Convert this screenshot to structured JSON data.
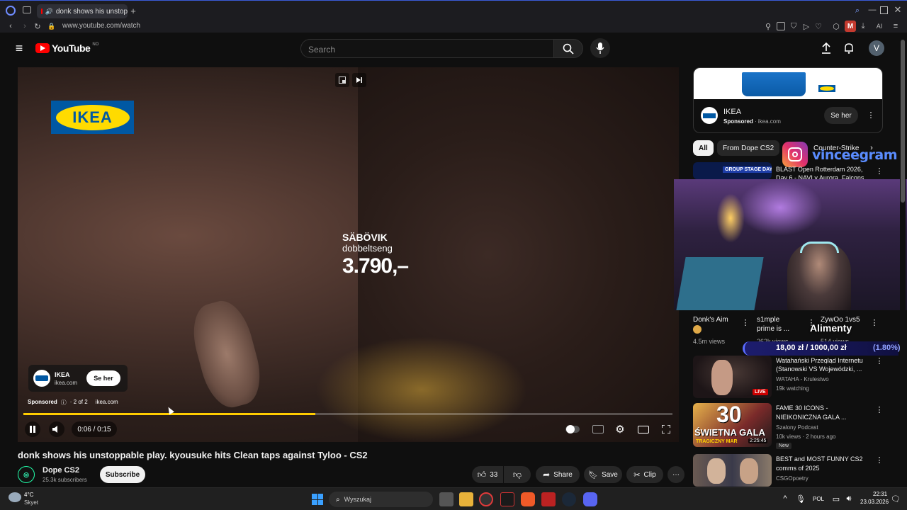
{
  "browser": {
    "tab_title": "donk shows his unstop",
    "url": "www.youtube.com/watch",
    "ai_label": "AI"
  },
  "header": {
    "logo_text": "YouTube",
    "region": "NO",
    "search_placeholder": "Search",
    "avatar_letter": "V"
  },
  "ad_video": {
    "product_name": "SÄBÖVIK",
    "product_desc": "dobbeltseng",
    "price": "3.790,–",
    "logo_text": "IKEA",
    "overlay_name": "IKEA",
    "overlay_domain": "ikea.com",
    "overlay_button": "Se her",
    "sponsored_label": "Sponsored",
    "ad_count": "· 2 of 2",
    "ad_domain": "ikea.com",
    "progress_fraction": 0.45,
    "time_display": "0:06 / 0:15"
  },
  "video": {
    "title": "donk shows his unstoppable play. kyousuke hits Clean taps against Tyloo - CS2",
    "channel": "Dope CS2",
    "subscribers": "25.3k subscribers",
    "subscribe_label": "Subscribe",
    "likes": "33",
    "share_label": "Share",
    "save_label": "Save",
    "clip_label": "Clip"
  },
  "sidebar_ad": {
    "name": "IKEA",
    "sponsored": "Sponsored",
    "domain": "ikea.com",
    "button": "Se her"
  },
  "chips": [
    "All",
    "From Dope CS2",
    "Counter-Strike"
  ],
  "overlay": {
    "instagram_handle": "vinceegram",
    "alimenty_label": "Alimenty",
    "donation": "18,00 zł / 1000,00 zł",
    "donation_pct": "(1.80%)"
  },
  "recommendations": [
    {
      "title1": "BLAST Open Rotterdam 2026,",
      "title2": "Day 6 - NAVI v Aurora, Falcons",
      "thumb_text": "GROUP STAGE DAY 6"
    },
    {
      "title1": "Watahański Przegląd Internetu",
      "title2": "(Stanowski VS Wojewódzki, ...",
      "channel": "WATAHA - Krulestwo",
      "meta": "19k watching",
      "badge": "LIVE"
    },
    {
      "title1": "FAME 30 ICONS -",
      "title2": "NIEIKONICZNA GALA ...",
      "channel": "Szalony Podcast",
      "meta": "10k views · 2 hours ago",
      "badge": "New",
      "duration": "2:25:45",
      "thumb_text": "30",
      "thumb_text2": "ŚWIETNA GALA",
      "thumb_text3": "TRAGICZNY MAR"
    },
    {
      "title1": "BEST and MOST FUNNY CS2",
      "title2": "comms of 2025",
      "channel": "CSGOpoetry"
    }
  ],
  "shorts": [
    {
      "title": "Donk's Aim",
      "views": "4.5m views"
    },
    {
      "title1": "s1mple",
      "title2": "prime is ...",
      "views": "262k views"
    },
    {
      "title1": "ZywOo 1vs5",
      "views": "514 views"
    }
  ],
  "taskbar": {
    "temp": "4°C",
    "weather": "Skyet",
    "search": "Wyszukaj",
    "lang": "POL",
    "time": "22:31",
    "date": "23.03.2026"
  }
}
